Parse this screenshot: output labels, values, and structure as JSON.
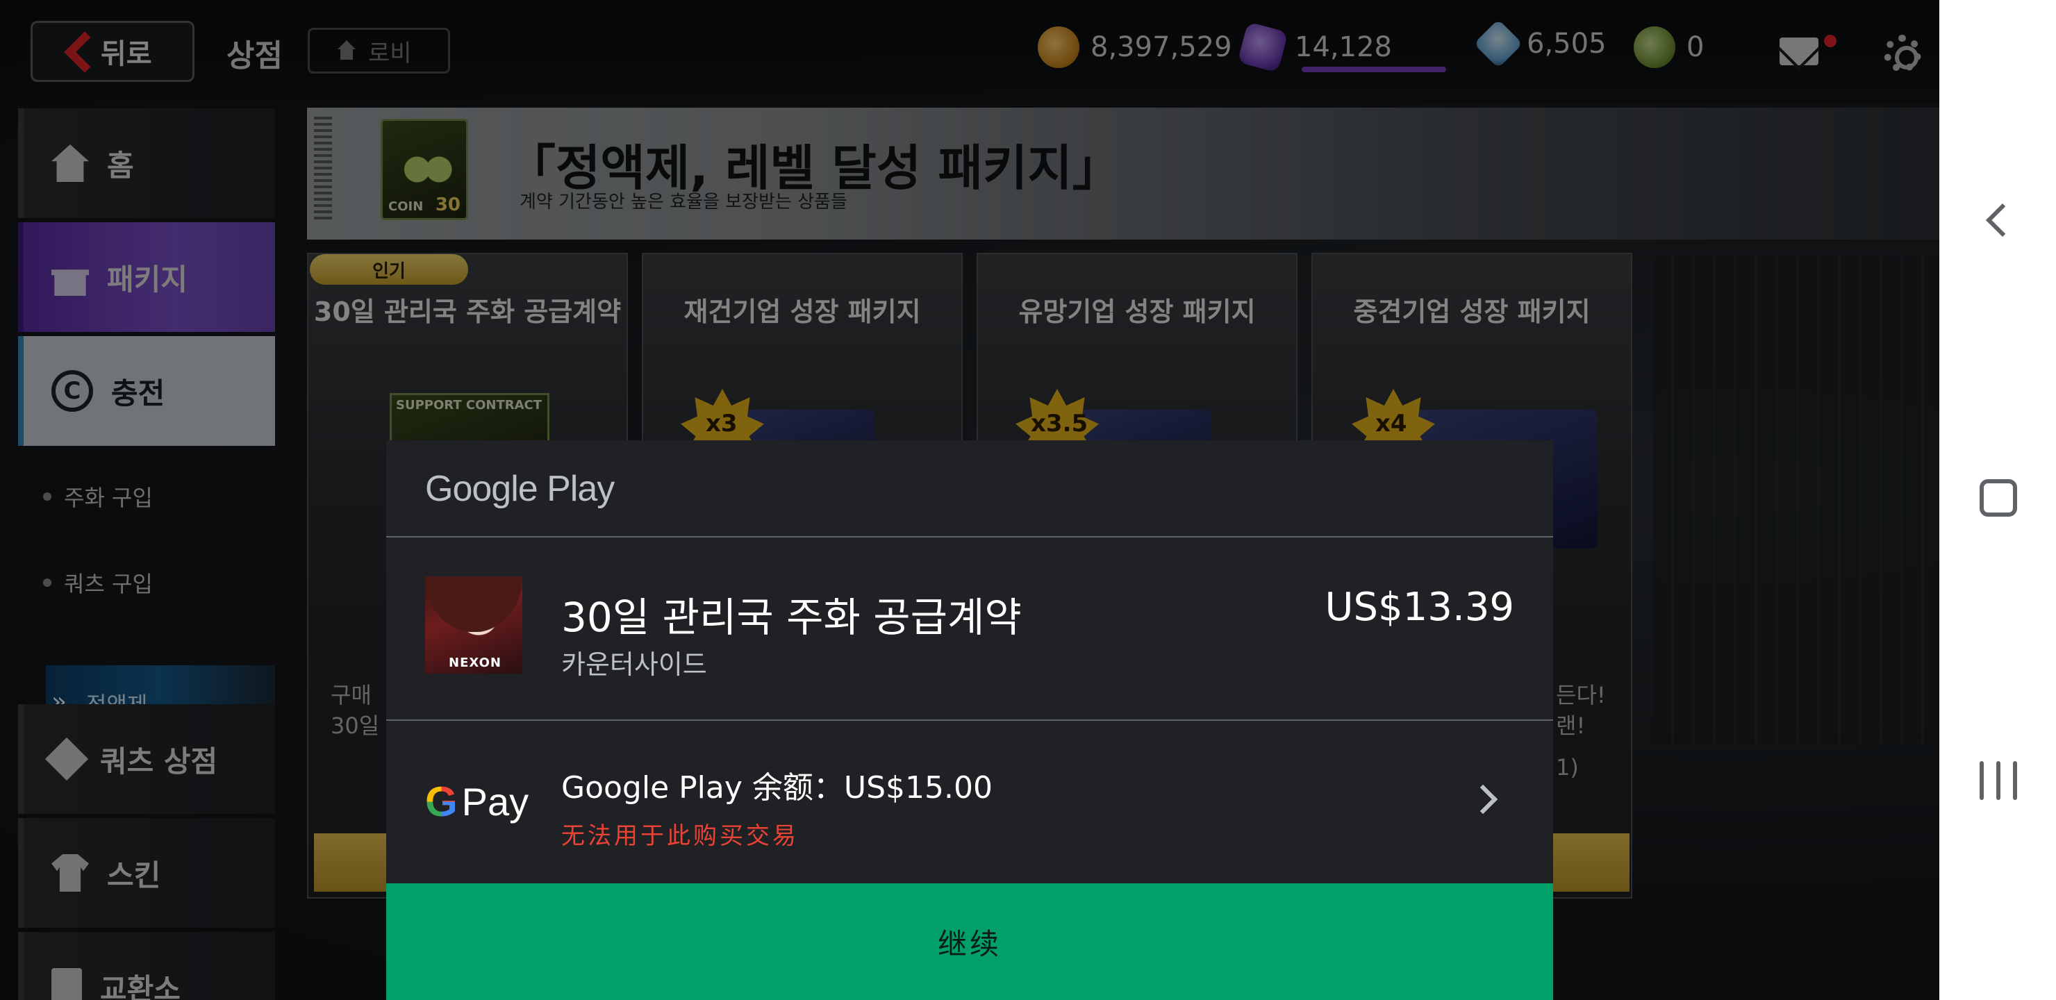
{
  "topbar": {
    "back_label": "뒤로",
    "shop_title": "상점",
    "lobby_label": "로비",
    "gold": "8,397,529",
    "purple": "14,128",
    "diamond": "6,505",
    "coin": "0"
  },
  "sidebar": {
    "items": [
      {
        "label": "홈"
      },
      {
        "label": "패키지"
      },
      {
        "label": "충전"
      },
      {
        "label": "쿼츠 상점"
      },
      {
        "label": "스킨"
      },
      {
        "label": "교환소"
      }
    ],
    "sub_items": [
      {
        "label": "주화 구입"
      },
      {
        "label": "쿼츠 구입"
      },
      {
        "label": "정액제"
      }
    ],
    "charge_icon_glyph": "C"
  },
  "banner": {
    "title": "「정액제, 레벨 달성 패키지」",
    "subtitle": "계약 기간동안 높은 효율을 보장받는 상품들",
    "coin_label": "COIN",
    "coin_num": "30"
  },
  "products": [
    {
      "title": "30일 관리국 주화 공급계약",
      "badge": "인기",
      "card_label": "SUPPORT CONTRACT",
      "desc_line1": "구매",
      "desc_line2": "30일"
    },
    {
      "title": "재건기업 성장 패키지",
      "multiplier": "x3"
    },
    {
      "title": "유망기업 성장 패키지",
      "multiplier": "x3.5"
    },
    {
      "title": "중견기업 성장 패키지",
      "multiplier": "x4",
      "desc_line1": "든다!",
      "desc_line2": "랜!",
      "desc_line3": "1)"
    }
  ],
  "google_play": {
    "header": "Google Play",
    "item_name": "30일 관리국 주화 공급계약",
    "developer": "카운터사이드",
    "price": "US$13.39",
    "thumb_label": "NEXON",
    "pay_g": "G",
    "pay_word": "Pay",
    "balance": "Google Play 余额：US$15.00",
    "error": "无法用于此购买交易",
    "continue": "继续"
  },
  "colors": {
    "continue_green": "#01a069",
    "error_red": "#ea4335",
    "sheet_bg": "#202124"
  }
}
